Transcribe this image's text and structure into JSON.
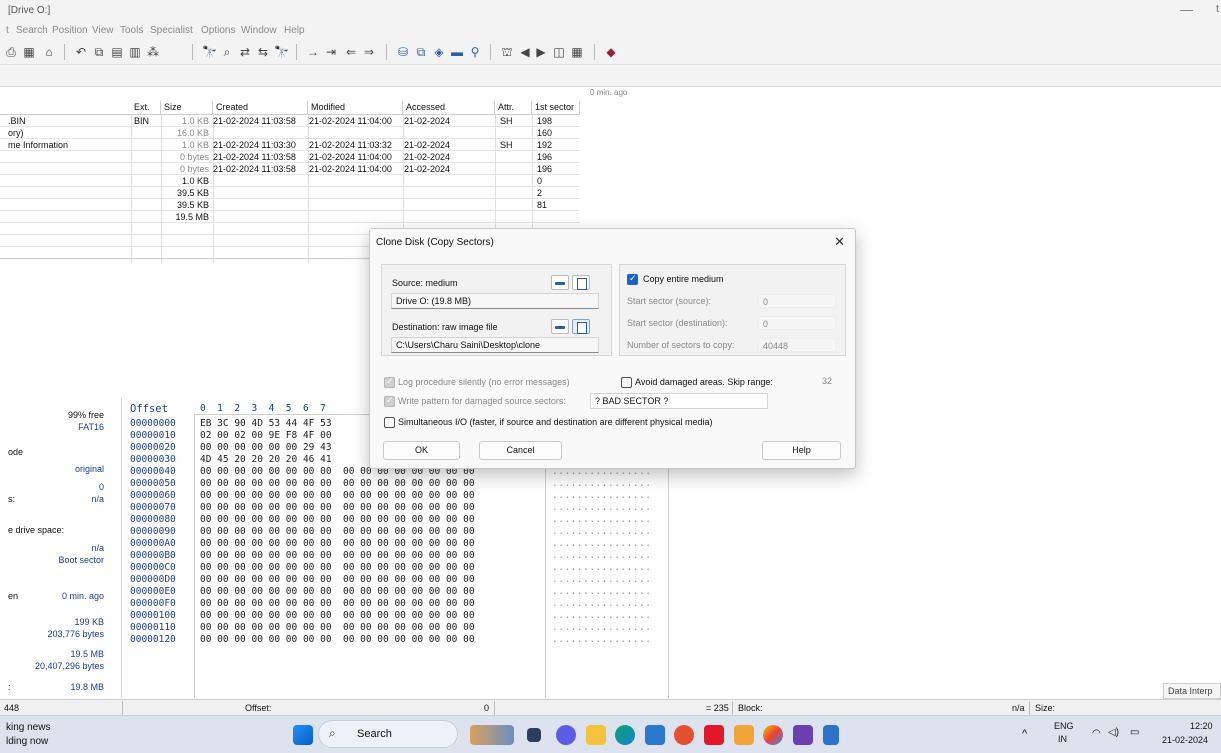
{
  "window": {
    "title": "[Drive O:]",
    "min_glyph": "—",
    "close_glyph": "t"
  },
  "menu": [
    "t",
    "Search",
    "Position",
    "View",
    "Tools",
    "Specialist",
    "Options",
    "Window",
    "Help"
  ],
  "path_bar": {
    "refresh_text": "0 min. ago"
  },
  "file_table": {
    "headers": [
      "Ext.",
      "Size",
      "Created",
      "Modified",
      "Accessed",
      "Attr.",
      "1st sector"
    ],
    "rows": [
      {
        "name": ".BIN",
        "ext": "BIN",
        "size": "1.0 KB",
        "created": "21-02-2024  11:03:58",
        "modified": "21-02-2024  11:04:00",
        "accessed": "21-02-2024",
        "attr": "SH",
        "sector": "198"
      },
      {
        "name": "ory)",
        "ext": "",
        "size": "16.0 KB",
        "created": "",
        "modified": "",
        "accessed": "",
        "attr": "",
        "sector": "160"
      },
      {
        "name": "me Information",
        "ext": "",
        "size": "1.0 KB",
        "created": "21-02-2024  11:03:30",
        "modified": "21-02-2024  11:03:32",
        "accessed": "21-02-2024",
        "attr": "SH",
        "sector": "192"
      },
      {
        "name": "",
        "ext": "",
        "size": "0 bytes",
        "created": "21-02-2024  11:03:58",
        "modified": "21-02-2024  11:04:00",
        "accessed": "21-02-2024",
        "attr": "",
        "sector": "196"
      },
      {
        "name": "",
        "ext": "",
        "size": "0 bytes",
        "created": "21-02-2024  11:03:58",
        "modified": "21-02-2024  11:04:00",
        "accessed": "21-02-2024",
        "attr": "",
        "sector": "196"
      },
      {
        "name": "",
        "ext": "",
        "size": "1.0 KB",
        "created": "",
        "modified": "",
        "accessed": "",
        "attr": "",
        "sector": "0"
      },
      {
        "name": "",
        "ext": "",
        "size": "39.5 KB",
        "created": "",
        "modified": "",
        "accessed": "",
        "attr": "",
        "sector": "2"
      },
      {
        "name": "",
        "ext": "",
        "size": "39.5 KB",
        "created": "",
        "modified": "",
        "accessed": "",
        "attr": "",
        "sector": "81"
      },
      {
        "name": "",
        "ext": "",
        "size": "19.5 MB",
        "created": "",
        "modified": "",
        "accessed": "",
        "attr": "",
        "sector": ""
      }
    ]
  },
  "info_panel": {
    "free": "99% free",
    "fs": "FAT16",
    "mode_label": "ode",
    "mode_value": "original",
    "zero": "0",
    "s_label": "s:",
    "na1": "n/a",
    "drive_space": "e drive space:",
    "na2": "n/a",
    "boot": "Boot sector",
    "en_label": "en",
    "ago": "0 min. ago",
    "kb199": "199 KB",
    "bytes1": "203,776 bytes",
    "mb195": "19.5 MB",
    "bytes2": "20,407,296 bytes",
    "mb198": "19.8 MB",
    "colon": ":"
  },
  "hex": {
    "offset_header": "Offset",
    "col_header": "0  1  2  3  4  5  6  7",
    "rows": [
      {
        "off": "00000000",
        "bytes": "EB 3C 90 4D 53 44 4F 53",
        "ascii": ""
      },
      {
        "off": "00000010",
        "bytes": "02 00 02 00 9E F8 4F 00",
        "ascii": ""
      },
      {
        "off": "00000020",
        "bytes": "00 00 00 00 00 00 29 43",
        "ascii": ""
      },
      {
        "off": "00000030",
        "bytes": "4D 45 20 20 20 20 46 41",
        "ascii": ""
      },
      {
        "off": "00000040",
        "bytes": "00 00 00 00 00 00 00 00  00 00 00 00 00 00 00 00",
        "ascii": "................"
      },
      {
        "off": "00000050",
        "bytes": "00 00 00 00 00 00 00 00  00 00 00 00 00 00 00 00",
        "ascii": "................"
      },
      {
        "off": "00000060",
        "bytes": "00 00 00 00 00 00 00 00  00 00 00 00 00 00 00 00",
        "ascii": "................"
      },
      {
        "off": "00000070",
        "bytes": "00 00 00 00 00 00 00 00  00 00 00 00 00 00 00 00",
        "ascii": "................"
      },
      {
        "off": "00000080",
        "bytes": "00 00 00 00 00 00 00 00  00 00 00 00 00 00 00 00",
        "ascii": "................"
      },
      {
        "off": "00000090",
        "bytes": "00 00 00 00 00 00 00 00  00 00 00 00 00 00 00 00",
        "ascii": "................"
      },
      {
        "off": "000000A0",
        "bytes": "00 00 00 00 00 00 00 00  00 00 00 00 00 00 00 00",
        "ascii": "................"
      },
      {
        "off": "000000B0",
        "bytes": "00 00 00 00 00 00 00 00  00 00 00 00 00 00 00 00",
        "ascii": "................"
      },
      {
        "off": "000000C0",
        "bytes": "00 00 00 00 00 00 00 00  00 00 00 00 00 00 00 00",
        "ascii": "................"
      },
      {
        "off": "000000D0",
        "bytes": "00 00 00 00 00 00 00 00  00 00 00 00 00 00 00 00",
        "ascii": "................"
      },
      {
        "off": "000000E0",
        "bytes": "00 00 00 00 00 00 00 00  00 00 00 00 00 00 00 00",
        "ascii": "................"
      },
      {
        "off": "000000F0",
        "bytes": "00 00 00 00 00 00 00 00  00 00 00 00 00 00 00 00",
        "ascii": "................"
      },
      {
        "off": "00000100",
        "bytes": "00 00 00 00 00 00 00 00  00 00 00 00 00 00 00 00",
        "ascii": "................"
      },
      {
        "off": "00000110",
        "bytes": "00 00 00 00 00 00 00 00  00 00 00 00 00 00 00 00",
        "ascii": "................"
      },
      {
        "off": "00000120",
        "bytes": "00 00 00 00 00 00 00 00  00 00 00 00 00 00 00 00",
        "ascii": "................"
      }
    ]
  },
  "status_bar": {
    "left": "448",
    "offset_label": "Offset:",
    "offset_value": "0",
    "eq": "= 235",
    "block_label": "Block:",
    "na": "n/a",
    "size_label": "Size:",
    "data_interp": "Data Interp"
  },
  "dialog": {
    "title": "Clone Disk (Copy Sectors)",
    "close": "✕",
    "source_label": "Source: medium",
    "source_value": "Drive O: (19.8 MB)",
    "dest_label": "Destination: raw image file",
    "dest_value": "C:\\Users\\Charu Saini\\Desktop\\clone",
    "copy_entire": "Copy entire medium",
    "start_src_label": "Start sector (source):",
    "start_src_value": "0",
    "start_dst_label": "Start sector (destination):",
    "start_dst_value": "0",
    "num_sectors_label": "Number of sectors to copy:",
    "num_sectors_value": "40448",
    "log_silently": "Log procedure silently (no error messages)",
    "avoid_damaged": "Avoid damaged areas. Skip range:",
    "skip_range": "32",
    "write_pattern": "Write pattern for damaged source sectors:",
    "pattern_value": "? BAD SECTOR ?",
    "simultaneous": "Simultaneous I/O (faster, if source and destination are different physical media)",
    "ok": "OK",
    "cancel": "Cancel",
    "help": "Help"
  },
  "taskbar": {
    "news1": "king news",
    "news2": "lding now",
    "search": "Search",
    "lang1": "ENG",
    "lang2": "IN",
    "time": "12:20",
    "date": "21-02-2024",
    "chevron": "^"
  },
  "colors": {
    "accent": "#1c63c8",
    "hex_offset": "#1b3f8f",
    "taskbar": "#dce3ee"
  }
}
